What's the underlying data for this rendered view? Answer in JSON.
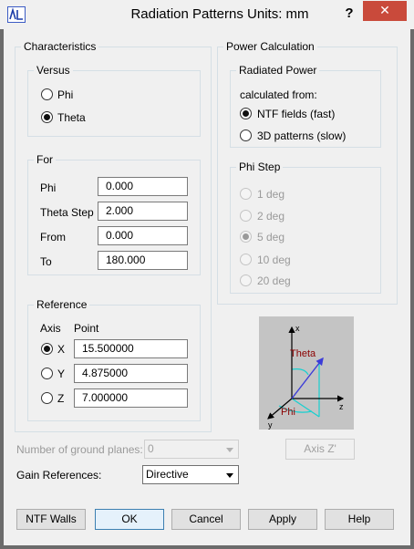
{
  "window": {
    "title": "Radiation Patterns   Units: mm",
    "help_label": "?",
    "close_label": "✕"
  },
  "characteristics": {
    "legend": "Characteristics",
    "versus": {
      "legend": "Versus",
      "options": [
        {
          "label": "Phi",
          "checked": false
        },
        {
          "label": "Theta",
          "checked": true
        }
      ]
    },
    "for": {
      "legend": "For",
      "rows": [
        {
          "label": "Phi",
          "value": "0.000"
        },
        {
          "label": "Theta Step",
          "value": "2.000"
        },
        {
          "label": "From",
          "value": "0.000"
        },
        {
          "label": "To",
          "value": "180.000"
        }
      ]
    },
    "reference": {
      "legend": "Reference",
      "axis_header": "Axis",
      "point_header": "Point",
      "rows": [
        {
          "axis": "X",
          "value": "15.500000",
          "checked": true
        },
        {
          "axis": "Y",
          "value": "4.875000",
          "checked": false
        },
        {
          "axis": "Z",
          "value": "7.000000",
          "checked": false
        }
      ]
    }
  },
  "power": {
    "legend": "Power Calculation",
    "radiated": {
      "legend": "Radiated Power",
      "caption": "calculated from:",
      "options": [
        {
          "label": "NTF fields (fast)",
          "checked": true
        },
        {
          "label": "3D patterns (slow)",
          "checked": false
        }
      ]
    },
    "phi_step": {
      "legend": "Phi Step",
      "options": [
        {
          "label": "1 deg",
          "checked": false
        },
        {
          "label": "2 deg",
          "checked": false
        },
        {
          "label": "5 deg",
          "checked": true
        },
        {
          "label": "10 deg",
          "checked": false
        },
        {
          "label": "20 deg",
          "checked": false
        }
      ]
    }
  },
  "axis_diagram": {
    "x_label": "x",
    "y_label": "y",
    "z_label": "z",
    "theta_label": "Theta",
    "phi_label": "Phi"
  },
  "ground_planes": {
    "label": "Number of ground planes:",
    "value": "0"
  },
  "axis_z_button": "Axis Z'",
  "gain": {
    "label": "Gain References:",
    "value": "Directive"
  },
  "footer": {
    "ntf_walls": "NTF Walls",
    "ok": "OK",
    "cancel": "Cancel",
    "apply": "Apply",
    "help": "Help"
  },
  "colors": {
    "close": "#c94a3b",
    "theta": "#8b0000",
    "arrow": "#3b3bd8",
    "cyan": "#18d0d0"
  }
}
